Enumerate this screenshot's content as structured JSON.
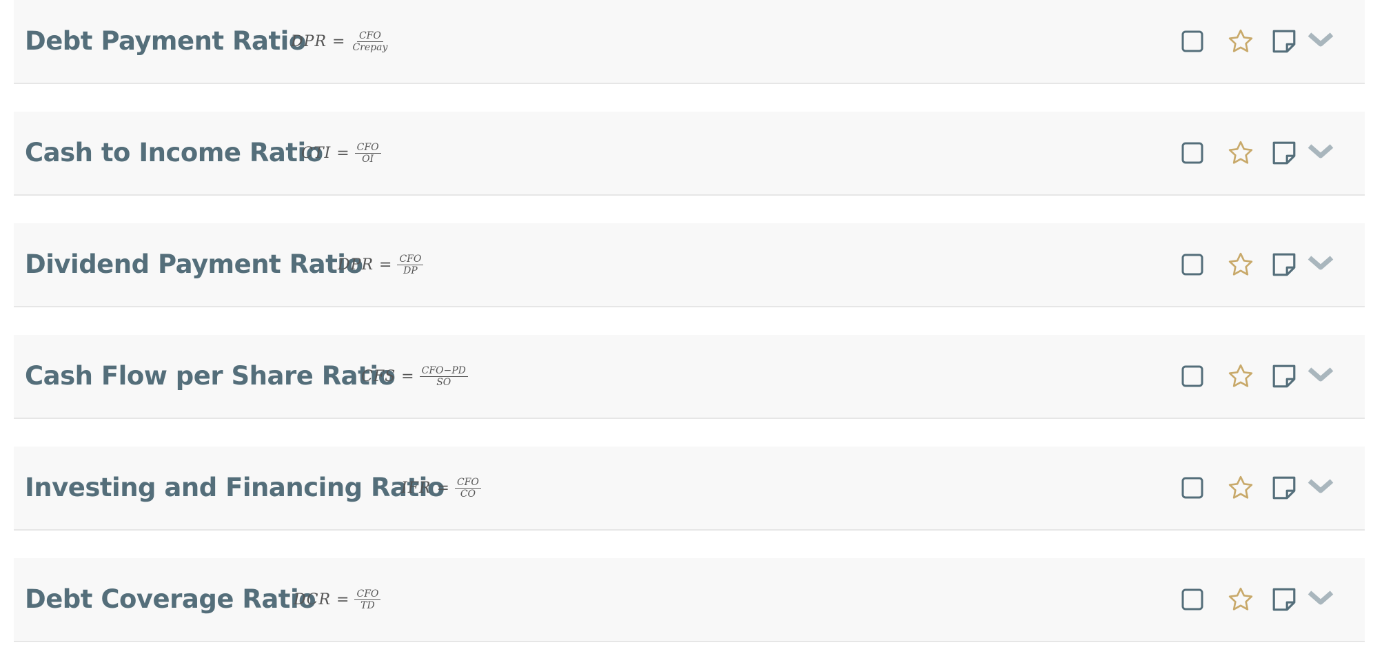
{
  "ratios": [
    {
      "title": "Debt Payment Ratio",
      "formula_lhs": "DPR",
      "formula_eq": "=",
      "numerator": "CFO",
      "denominator": "Crepay"
    },
    {
      "title": "Cash to Income Ratio",
      "formula_lhs": "CTI",
      "formula_eq": "=",
      "numerator": "CFO",
      "denominator": "OI"
    },
    {
      "title": "Dividend Payment Ratio",
      "formula_lhs": "DPR",
      "formula_eq": "=",
      "numerator": "CFO",
      "denominator": "DP"
    },
    {
      "title": "Cash Flow per Share Ratio",
      "formula_lhs": "CFS",
      "formula_eq": "=",
      "numerator": "CFO−PD",
      "denominator": "SO"
    },
    {
      "title": "Investing and Financing Ratio",
      "formula_lhs": "IFR",
      "formula_eq": "=",
      "numerator": "CFO",
      "denominator": "CO"
    },
    {
      "title": "Debt Coverage Ratio",
      "formula_lhs": "DCR",
      "formula_eq": "=",
      "numerator": "CFO",
      "denominator": "TD"
    }
  ],
  "icons": {
    "checkbox": "checkbox-icon",
    "star": "star-icon",
    "note": "note-icon",
    "chevron": "chevron-down-icon"
  },
  "colors": {
    "title": "#546e7a",
    "card_background": "#f8f8f8",
    "icon_slate": "#546e7a",
    "star_gold": "#c8a96a",
    "chevron_gray": "#a9b6bd"
  }
}
